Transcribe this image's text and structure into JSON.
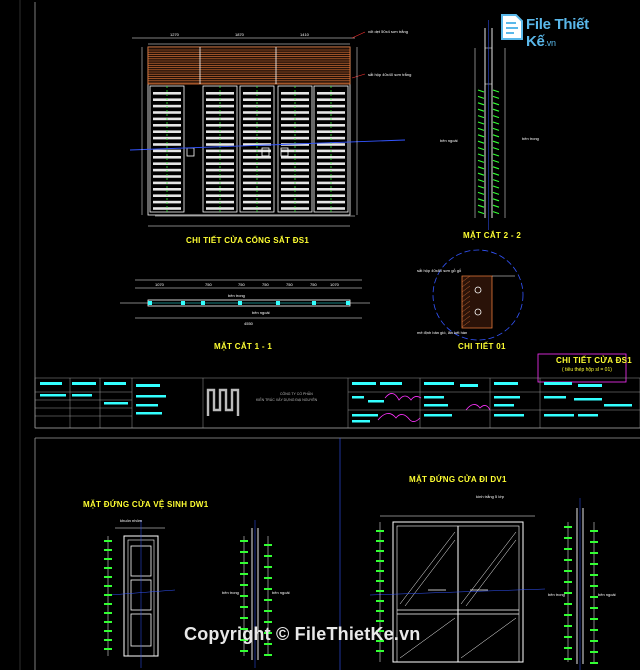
{
  "watermark": {
    "logo_text": "File Thiết Kế",
    "logo_suffix": ".vn",
    "copyright": "Copyright © FileThietKe.vn"
  },
  "sheet1": {
    "gate_title": "CHI TIẾT CỬA CỔNG SẮT ĐS1",
    "section22_title": "MẶT CẮT 2 - 2",
    "section11_title": "MẶT CẮT 1 - 1",
    "detail01_title": "CHI TIẾT 01",
    "box_title": "CHI TIẾT CỬA ĐS1",
    "box_sub": "( tiêu thép hộp sl = 01)",
    "gate_dims_top": [
      "1270",
      "1870",
      "1410"
    ],
    "sec11_dims": [
      "1070",
      "750",
      "750",
      "750",
      "750",
      "750",
      "1070"
    ],
    "sec11_total": "4550",
    "labels": {
      "ann1": "vỏt dẹt 50x4 sơn trắng",
      "ann2": "sắt hộp 40x40 sơn trắng",
      "sec11_in": "bên trong",
      "sec11_out": "bên ngoài",
      "sec22_out": "bên ngoài",
      "sec22_in": "bên trong",
      "det_ann1": "sắt hộp 40x80 sơn gỗ gỗ",
      "det_ann2": "mê định bản gió, lăn kết hàn"
    },
    "titleblock": {
      "company": "CÔNG TY CỔ PHẦN",
      "company2": "KIẾN TRÚC XÂY DỰNG ĐẠI NGUYÊN"
    }
  },
  "sheet2": {
    "dw1_title": "MẶT ĐỨNG CỬA VỆ SINH DW1",
    "d1_title": "MẶT ĐỨNG CỬA ĐI DV1",
    "dw1_ann": "khuôn nhôm",
    "dw1_in": "bên trong",
    "dw1_out": "bên ngoài",
    "d1_ann": "kính trắng 5 lớp",
    "d1_in": "bên trong",
    "d1_out": "bên ngoài"
  }
}
